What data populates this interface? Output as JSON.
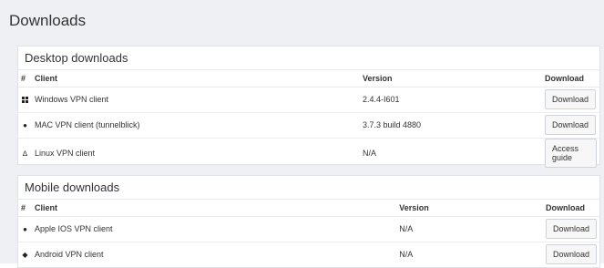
{
  "page": {
    "title": "Downloads"
  },
  "desktop": {
    "heading": "Desktop downloads",
    "headers": {
      "num": "#",
      "client": "Client",
      "version": "Version",
      "download": "Download"
    },
    "rows": [
      {
        "icon": "windows-icon",
        "client": "Windows VPN client",
        "version": "2.4.4-I601",
        "action": "Download"
      },
      {
        "icon": "apple-icon",
        "client": "MAC VPN client (tunnelblick)",
        "version": "3.7.3 build 4880",
        "action": "Download"
      },
      {
        "icon": "linux-icon",
        "client": "Linux VPN client",
        "version": "N/A",
        "action": "Access guide"
      }
    ]
  },
  "mobile": {
    "heading": "Mobile downloads",
    "headers": {
      "num": "#",
      "client": "Client",
      "version": "Version",
      "download": "Download"
    },
    "rows": [
      {
        "icon": "apple-icon",
        "client": "Apple IOS VPN client",
        "version": "N/A",
        "action": "Download"
      },
      {
        "icon": "android-icon",
        "client": "Android VPN client",
        "version": "N/A",
        "action": "Download"
      }
    ]
  }
}
